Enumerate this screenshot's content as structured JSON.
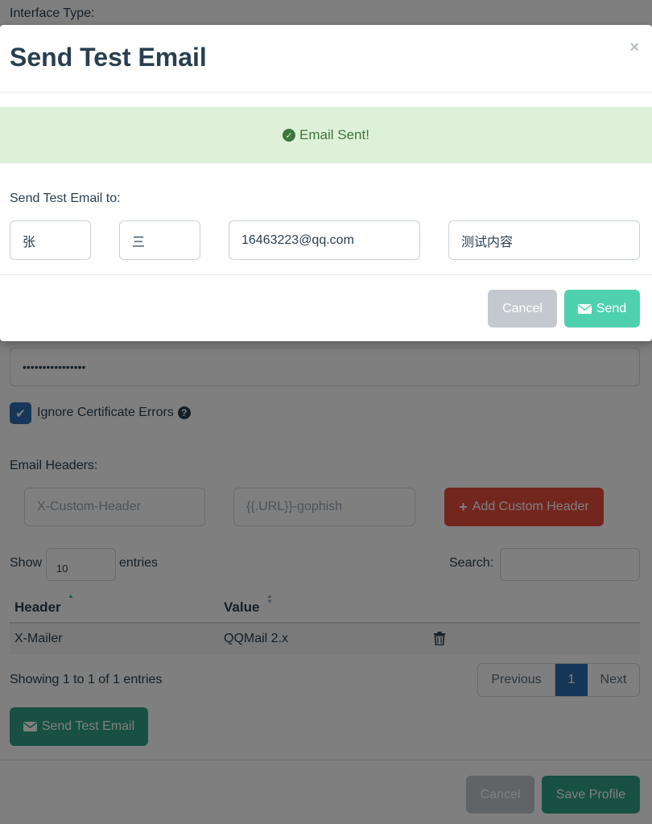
{
  "background": {
    "interface_type_label": "Interface Type:",
    "password_value": "••••••••••••••••",
    "ignore_cert_label": "Ignore Certificate Errors",
    "email_headers_label": "Email Headers:",
    "custom_header_placeholder": "X-Custom-Header",
    "custom_value_placeholder": "{{.URL}}-gophish",
    "add_header_button": "Add Custom Header",
    "show_label": "Show",
    "entries_select_value": "10",
    "entries_label": "entries",
    "search_label": "Search:",
    "table": {
      "columns": [
        "Header",
        "Value"
      ],
      "rows": [
        {
          "header": "X-Mailer",
          "value": "QQMail 2.x"
        }
      ]
    },
    "showing_text": "Showing 1 to 1 of 1 entries",
    "pagination": {
      "previous": "Previous",
      "current": "1",
      "next": "Next"
    },
    "send_test_email_button": "Send Test Email",
    "footer": {
      "cancel": "Cancel",
      "save": "Save Profile"
    }
  },
  "modal": {
    "title": "Send Test Email",
    "close": "×",
    "alert": "Email Sent!",
    "send_to_label": "Send Test Email to:",
    "inputs": {
      "first_name": "张",
      "last_name": "三",
      "email": "16463223@qq.com",
      "position": "测试内容"
    },
    "cancel_button": "Cancel",
    "send_button": "Send"
  },
  "colors": {
    "primary": "#2f6fb0",
    "success_green": "#37c09c",
    "danger_red": "#e74c3c",
    "alert_bg": "#dff0d8",
    "alert_text": "#3c763d",
    "text": "#283f50"
  },
  "icons": [
    "check-circle-icon",
    "envelope-icon",
    "plus-icon",
    "question-circle-icon",
    "trash-icon",
    "checkmark-icon",
    "sort-icon"
  ]
}
